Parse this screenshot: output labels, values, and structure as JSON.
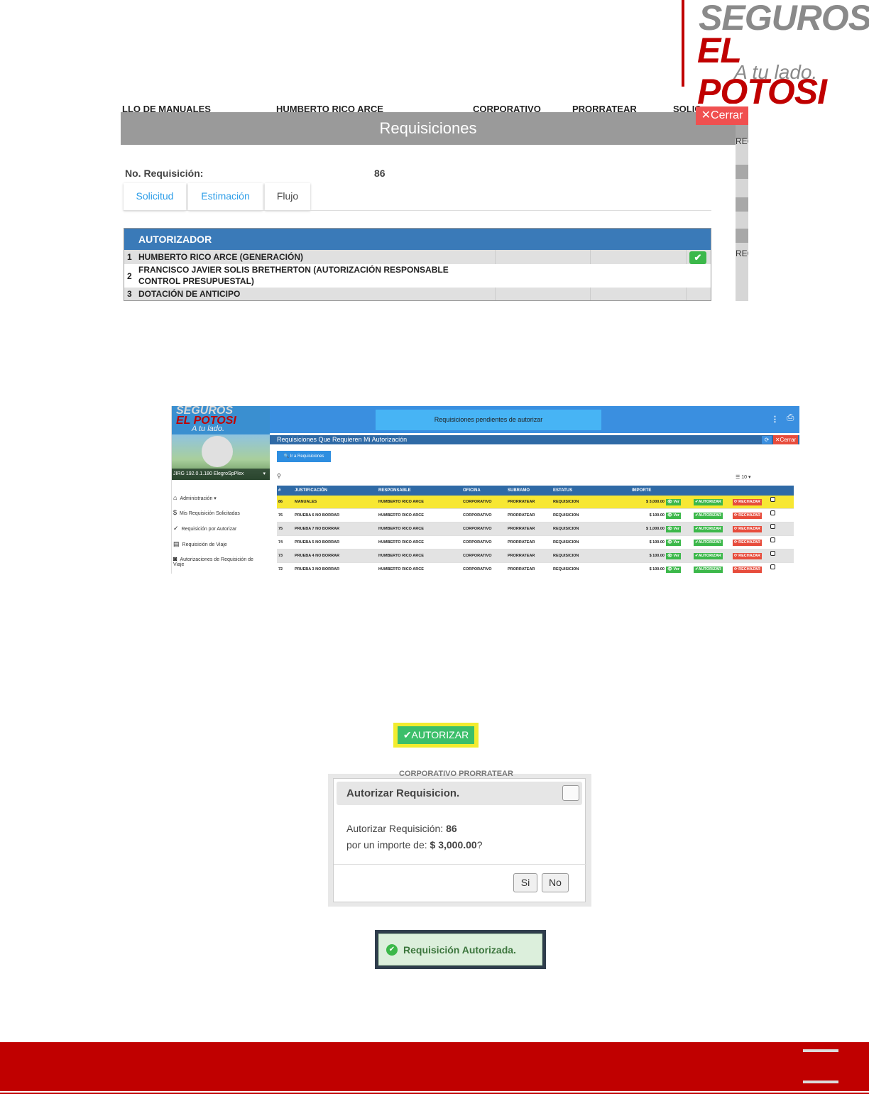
{
  "brand": {
    "line1": "SEGUROS",
    "line2": "EL POTOSI",
    "tagline": "A tu lado."
  },
  "shot1": {
    "bg_row": [
      "LLO DE MANUALES",
      "HUMBERTO RICO ARCE",
      "CORPORATIVO",
      "PRORRATEAR",
      "SOLIC"
    ],
    "close_label": "✕Cerrar",
    "title": "Requisiciones",
    "req_label": "No. Requisición:",
    "req_value": "86",
    "tabs": [
      "Solicitud",
      "Estimación",
      "Flujo"
    ],
    "side_text": [
      "REC",
      "REC"
    ],
    "table_header": "AUTORIZADOR",
    "rows": [
      {
        "n": "1",
        "line1": "HUMBERTO RICO ARCE (GENERACIÓN)",
        "line2": ""
      },
      {
        "n": "2",
        "line1": "FRANCISCO JAVIER SOLIS BRETHERTON (AUTORIZACIÓN RESPONSABLE",
        "line2": "CONTROL PRESUPUESTAL)"
      },
      {
        "n": "3",
        "line1": "DOTACIÓN DE ANTICIPO",
        "line2": ""
      }
    ],
    "check_icon": "check-icon"
  },
  "shot2": {
    "brand1": "SEGUROS",
    "brand2": "EL POTOSI",
    "brand3": "A tu lado.",
    "user": "JIRG 192.0.1.180 ElegroSpPlex",
    "nav": [
      {
        "icon": "home-icon",
        "glyph": "⌂",
        "label": "Administración ▾"
      },
      {
        "icon": "dollar-icon",
        "glyph": "$",
        "label": "Mis Requisición Solicitadas"
      },
      {
        "icon": "check-icon",
        "glyph": "✓",
        "label": "Requisición por Autorizar"
      },
      {
        "icon": "doc-icon",
        "glyph": "▤",
        "label": "Requisición de Viaje"
      },
      {
        "icon": "user-icon",
        "glyph": "◙",
        "label": "Autorizaciones de Requisición de Viaje"
      }
    ],
    "top_title": "Requisiciones pendientes de autorizar",
    "bar_title": "Requisiciones Que Requieren Mi Autorización",
    "close_label": "✕Cerrar",
    "ir_button": "🔍 Ir a Requisiciones",
    "page_length": "10",
    "columns": [
      "#",
      "JUSTIFICACIÓN",
      "RESPONSABLE",
      "OFICINA",
      "SUBRAMO",
      "ESTATUS",
      "IMPORTE"
    ],
    "rows": [
      {
        "id": "86",
        "just": "MANUALES",
        "resp": "HUMBERTO RICO ARCE",
        "ofi": "CORPORATIVO",
        "sub": "PRORRATEAR",
        "est": "REQUISICION",
        "imp": "$ 3,000.00"
      },
      {
        "id": "76",
        "just": "PRUEBA 6 NO BORRAR",
        "resp": "HUMBERTO RICO ARCE",
        "ofi": "CORPORATIVO",
        "sub": "PRORRATEAR",
        "est": "REQUISICION",
        "imp": "$ 100.00"
      },
      {
        "id": "75",
        "just": "PRUEBA 7 NO BORRAR",
        "resp": "HUMBERTO RICO ARCE",
        "ofi": "CORPORATIVO",
        "sub": "PRORRATEAR",
        "est": "REQUISICION",
        "imp": "$ 1,000.00"
      },
      {
        "id": "74",
        "just": "PRUEBA 5 NO BORRAR",
        "resp": "HUMBERTO RICO ARCE",
        "ofi": "CORPORATIVO",
        "sub": "PRORRATEAR",
        "est": "REQUISICION",
        "imp": "$ 100.00"
      },
      {
        "id": "73",
        "just": "PRUEBA 4 NO BORRAR",
        "resp": "HUMBERTO RICO ARCE",
        "ofi": "CORPORATIVO",
        "sub": "PRORRATEAR",
        "est": "REQUISICION",
        "imp": "$ 100.00"
      },
      {
        "id": "72",
        "just": "PRUEBA 3 NO BORRAR",
        "resp": "HUMBERTO RICO ARCE",
        "ofi": "CORPORATIVO",
        "sub": "PRORRATEAR",
        "est": "REQUISICION",
        "imp": "$ 100.00"
      }
    ],
    "ver_label": "👁 Ver",
    "aut_label": "✔AUTORIZAR",
    "rec_label": "⟳ RECHAZAR"
  },
  "autorizar_button": "✔AUTORIZAR",
  "dialog": {
    "bg_text": "CORPORATIVO      PRORRATEAR",
    "title": "Autorizar Requisicion.",
    "line1_prefix": "Autorizar Requisición: ",
    "line1_value": "86",
    "line2_prefix": "por un importe de: ",
    "line2_value": "$ 3,000.00",
    "line2_suffix": "?",
    "yes": "Si",
    "no": "No"
  },
  "toast": {
    "icon": "check-circle-icon",
    "text": "Requisición Autorizada."
  },
  "colors": {
    "brand_red": "#c00000",
    "header_blue": "#3a7ab8",
    "success_green": "#3cb84a",
    "highlight_yellow": "#f7e733"
  }
}
